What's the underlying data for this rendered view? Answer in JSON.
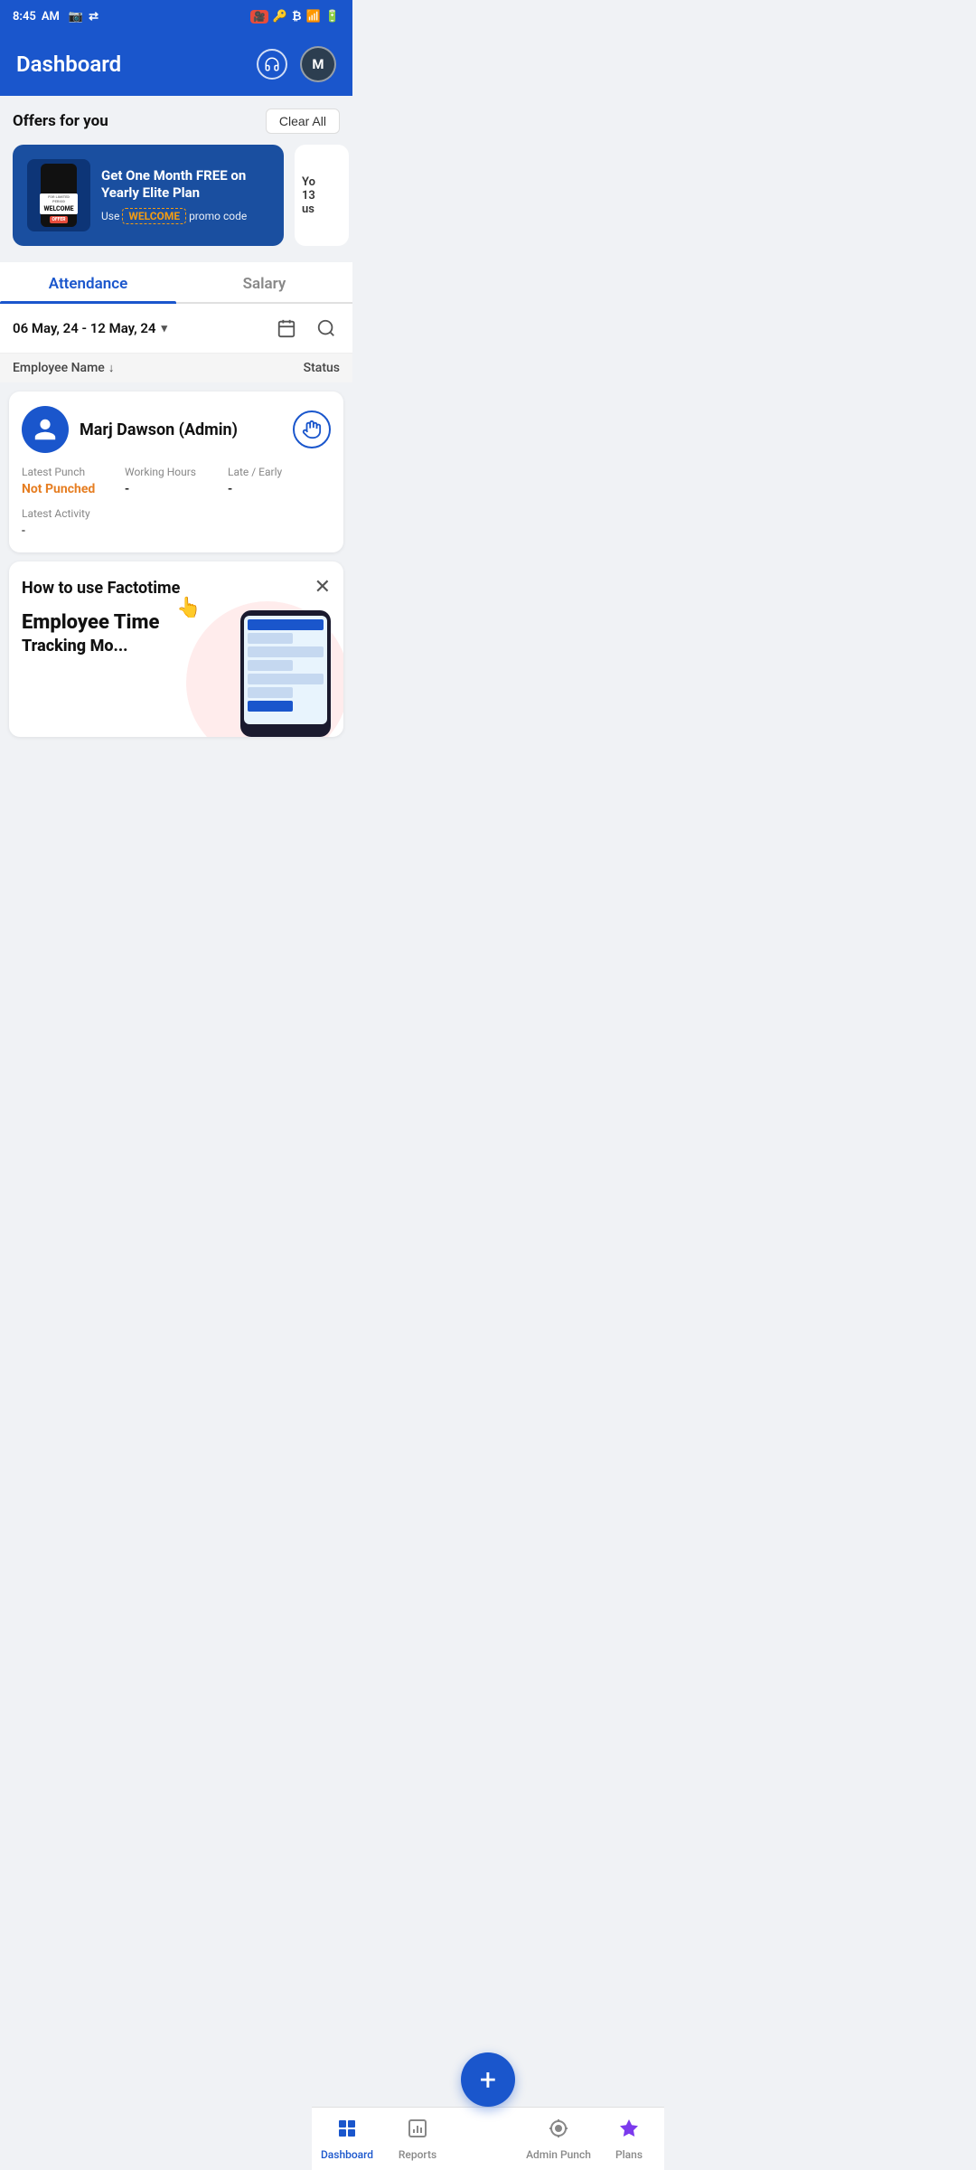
{
  "statusBar": {
    "time": "8:45",
    "amPm": "AM"
  },
  "header": {
    "title": "Dashboard",
    "avatarInitial": "M"
  },
  "offers": {
    "sectionTitle": "Offers for you",
    "clearAllLabel": "Clear All",
    "mainCard": {
      "headline": "Get One Month FREE on Yearly Elite Plan",
      "promoLine": "Use",
      "promoCode": "WELCOME",
      "promoSuffix": "promo code",
      "phoneLabel": "FOR LIMITED PERIOD",
      "welcomeLabel": "WELCOME",
      "offerLabel": "OFFER"
    },
    "partialCard": {
      "line1": "Yo",
      "line2": "13",
      "line3": "us"
    }
  },
  "tabs": {
    "items": [
      {
        "label": "Attendance",
        "active": true
      },
      {
        "label": "Salary",
        "active": false
      }
    ]
  },
  "filter": {
    "dateRange": "06 May, 24 - 12 May, 24"
  },
  "columns": {
    "employeeName": "Employee Name",
    "status": "Status"
  },
  "employeeCard": {
    "name": "Marj Dawson (Admin)",
    "latestPunchLabel": "Latest Punch",
    "latestPunchValue": "Not Punched",
    "workingHoursLabel": "Working Hours",
    "workingHoursValue": "-",
    "lateEarlyLabel": "Late / Early",
    "lateEarlyValue": "-",
    "latestActivityLabel": "Latest Activity",
    "latestActivityValue": "-"
  },
  "howToCard": {
    "title": "How to use Factotime",
    "mainText": "Employee Time",
    "subText": "Tracking Mo..."
  },
  "fab": {
    "label": "+"
  },
  "bottomNav": {
    "items": [
      {
        "label": "Dashboard",
        "iconType": "grid",
        "active": true
      },
      {
        "label": "Reports",
        "iconType": "bar-chart",
        "active": false
      },
      {
        "label": "",
        "iconType": "plus",
        "active": false,
        "isFab": true
      },
      {
        "label": "Admin Punch",
        "iconType": "location",
        "active": false
      },
      {
        "label": "Plans",
        "iconType": "star",
        "active": false,
        "purple": true
      }
    ]
  }
}
